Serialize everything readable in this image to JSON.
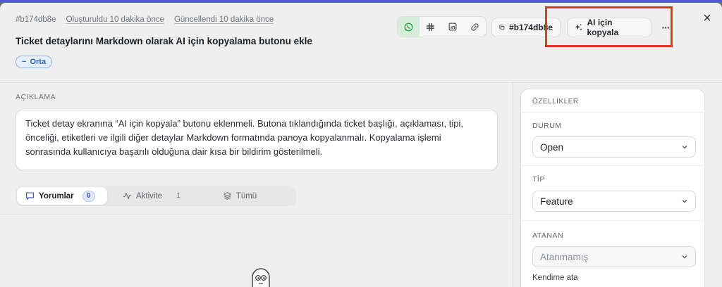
{
  "ticket": {
    "id": "#b174db8e",
    "created": "Oluşturuldu 10 dakika önce",
    "updated": "Güncellendi 10 dakika önce",
    "title": "Ticket detaylarını Markdown olarak AI için kopyalama butonu ekle",
    "priority": "Orta"
  },
  "toolbar": {
    "share_icons": [
      "whatsapp-icon",
      "slack-icon",
      "linkedin-icon",
      "link-icon"
    ],
    "copy_id_label": "#b174db8e",
    "ai_copy_label": "AI için kopyala",
    "more_label": "···",
    "close_label": "×"
  },
  "description": {
    "label": "AÇIKLAMA",
    "text": "Ticket detay ekranına “AI için kopyala” butonu eklenmeli. Butona tıklandığında ticket başlığı, açıklaması, tipi, önceliği, etiketleri ve ilgili diğer detaylar Markdown formatında panoya kopyalanmalı. Kopyalama işlemi sonrasında kullanıcıya başarılı olduğuna dair kısa bir bildirim gösterilmeli."
  },
  "tabs": [
    {
      "label": "Yorumlar",
      "count": "0"
    },
    {
      "label": "Aktivite",
      "count": "1"
    },
    {
      "label": "Tümü",
      "count": ""
    }
  ],
  "properties": {
    "title": "ÖZELLİKLER",
    "status": {
      "label": "DURUM",
      "value": "Open"
    },
    "type": {
      "label": "TİP",
      "value": "Feature"
    },
    "assignee": {
      "label": "ATANAN",
      "value": "Atanmamış",
      "assign_me": "Kendime ata"
    }
  },
  "colors": {
    "accent": "#4f5bd5",
    "highlight": "#e23a1f",
    "whatsapp": "#25a244"
  }
}
